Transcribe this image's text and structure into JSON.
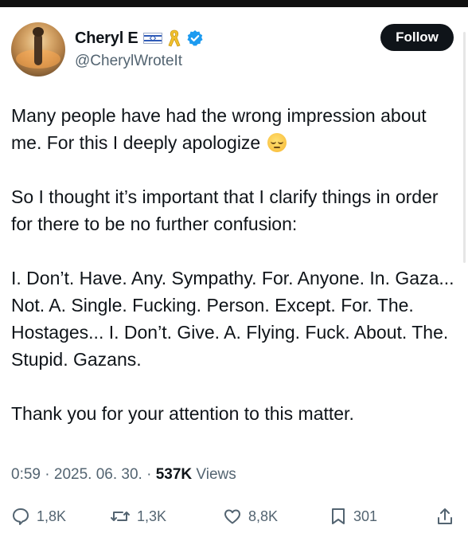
{
  "author": {
    "display_name": "Cheryl E",
    "handle": "@CherylWroteIt",
    "badges": [
      "israel-flag-icon",
      "yellow-ribbon-icon",
      "verified-badge-icon"
    ],
    "verified_color": "#1d9bf0"
  },
  "follow_label": "Follow",
  "tweet": {
    "paragraphs": [
      "Many people have had the wrong impression about me. For this I deeply apologize",
      "So I thought it’s important that I clarify things in order for there to be no further confusion:",
      "I. Don’t. Have. Any. Sympathy. For. Anyone. In. Gaza... Not. A. Single. Fucking. Person. Except. For. The. Hostages... I. Don’t. Give. A. Flying. Fuck. About. The. Stupid. Gazans.",
      "Thank you for your attention to this matter."
    ],
    "emoji": "pensive-face-emoji"
  },
  "meta": {
    "time": "0:59",
    "sep": "·",
    "date": "2025. 06. 30.",
    "views": "537K",
    "views_label": "Views"
  },
  "actions": {
    "replies": "1,8K",
    "reposts": "1,3K",
    "likes": "8,8K",
    "bookmarks": "301"
  },
  "colors": {
    "text": "#0f1419",
    "muted": "#536471",
    "button_bg": "#0f1419"
  }
}
